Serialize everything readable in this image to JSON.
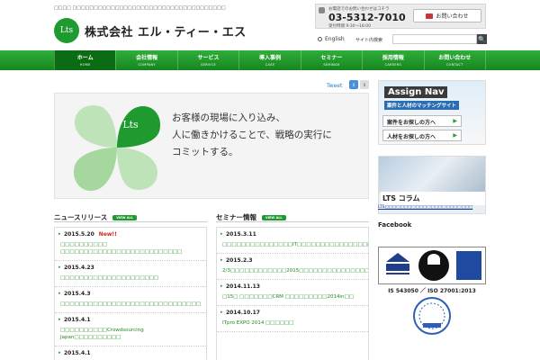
{
  "header": {
    "tagline": "□□□□ □□□□□□□□□□□□□□□□□□□□□□□□□□□□□□□□□□□□",
    "logo_mark": "Lts",
    "company_name": "株式会社 エル・ティー・エス",
    "contact_caption": "お電話でのお問い合わせはコチラ",
    "phone": "03-5312-7010",
    "hours": "受付時間 9:30〜18:00",
    "inquiry_label": "お問い合わせ",
    "language_label": "English",
    "site_search_label": "サイト内検索",
    "search_placeholder": "",
    "search_button_label": "🔍"
  },
  "nav": {
    "items": [
      {
        "jp": "ホーム",
        "en": "HOME"
      },
      {
        "jp": "会社情報",
        "en": "COMPANY"
      },
      {
        "jp": "サービス",
        "en": "SERVICE"
      },
      {
        "jp": "導入事例",
        "en": "CASE"
      },
      {
        "jp": "セミナー",
        "en": "SEMINAR"
      },
      {
        "jp": "採用情報",
        "en": "CAREERS"
      },
      {
        "jp": "お問い合わせ",
        "en": "CONTACT"
      }
    ]
  },
  "social": {
    "tweet_label": "Tweet",
    "count_a": "0",
    "count_b": "0"
  },
  "hero": {
    "logo_mark": "Lts",
    "line1": "お客様の現場に入り込み、",
    "line2": "人に働きかけることで、戦略の実行に",
    "line3": "コミットする。"
  },
  "sidebar": {
    "banner_title": "Assign Nav",
    "banner_sub": "案件と人材のマッチングサイト",
    "banner_btn1": "案件をお探しの方へ",
    "banner_btn2": "人材をお探しの方へ",
    "column_label": "LTS コラム",
    "column_link": "LTS□□□□□□□□□□□□□□□□□□□□□□□",
    "facebook_label": "Facebook",
    "cert_text": "IS 543050 ／ ISO 27001:2013"
  },
  "news": {
    "title": "ニュースリリース",
    "view_all": "VIEW ALL",
    "items": [
      {
        "date": "2015.5.20",
        "badge": "New!!",
        "text": "□□□□□□□□□□ □□□□□□□□□□□□□□□□□□□□□□□□□□"
      },
      {
        "date": "2015.4.23",
        "badge": "",
        "text": "□□□□□□□□□□□□□□□□□□□□□"
      },
      {
        "date": "2015.4.3",
        "badge": "",
        "text": "□□□□□□□□□□□□□□□□□□□□□□□□□□□□□□"
      },
      {
        "date": "2015.4.1",
        "badge": "",
        "text": "□□□□□□□□□□Crowdsourcing Japan□□□□□□□□□□"
      },
      {
        "date": "2015.4.1",
        "badge": "",
        "text": ""
      }
    ]
  },
  "seminar": {
    "title": "セミナー情報",
    "view_all": "VIEW ALL",
    "items": [
      {
        "date": "2015.3.11",
        "text": "□□□□□□□□□□□□□□□IT□□□□□□□□□□□□□□□□□□□□□□□□□□□□□□□□"
      },
      {
        "date": "2015.2.3",
        "text": "2/3□□□□□□□□□□□□2015□□□□□□□□□□□□□□□□□□□□□□□□"
      },
      {
        "date": "2014.11.13",
        "text": "□15□ □□□□□□□CRM □□□□□□□□□2014in□□"
      },
      {
        "date": "2014.10.17",
        "text": "ITpro EXPO 2014 □□□□□□"
      }
    ]
  }
}
